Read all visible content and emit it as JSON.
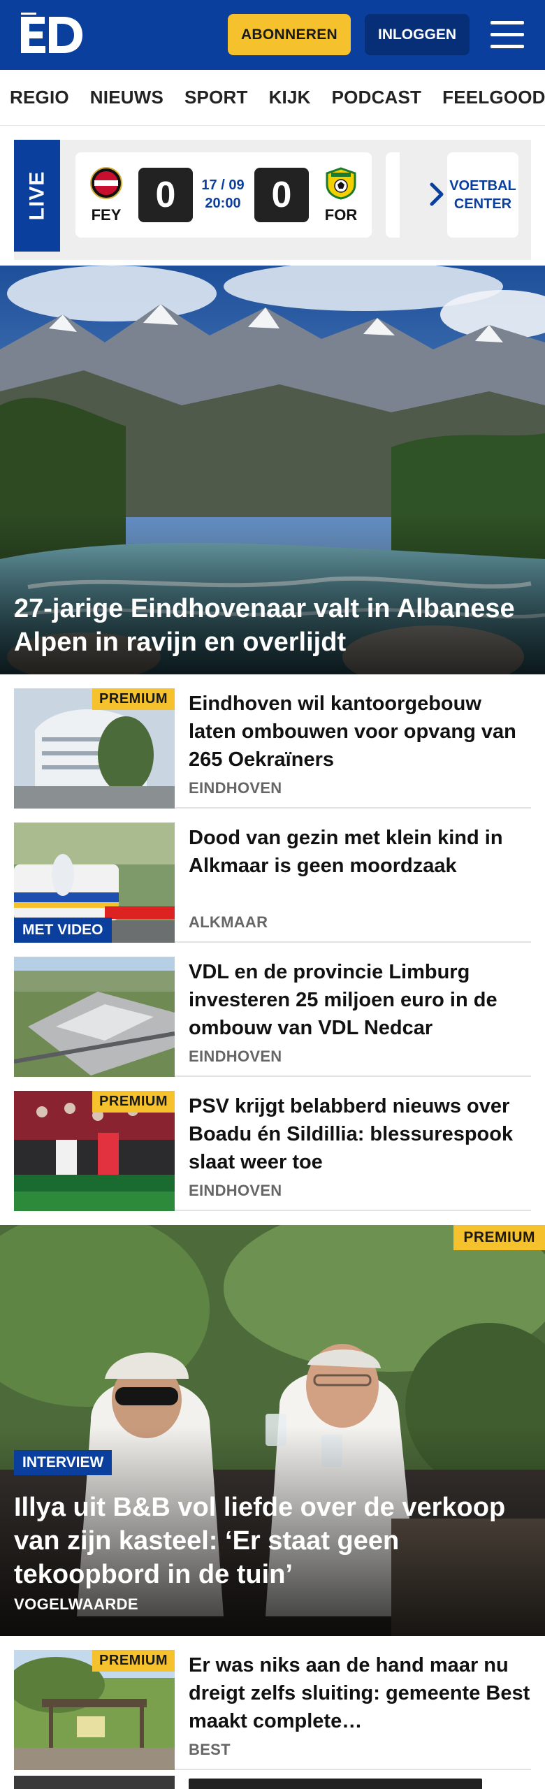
{
  "header": {
    "logo": "ED",
    "subscribe_label": "ABONNEREN",
    "login_label": "INLOGGEN"
  },
  "nav": {
    "items": [
      "REGIO",
      "NIEUWS",
      "SPORT",
      "KIJK",
      "PODCAST",
      "FEELGOOD"
    ]
  },
  "live": {
    "label": "LIVE",
    "home": {
      "abbr": "FEY",
      "score": "0"
    },
    "away": {
      "abbr": "FOR",
      "score": "0"
    },
    "date": "17 / 09",
    "time": "20:00",
    "voetbal_center": "VOETBAL CENTER"
  },
  "hero": {
    "title": "27-jarige Eindhovenaar valt in Albanese Alpen in ravijn en overlijdt"
  },
  "articles": [
    {
      "title": "Eindhoven wil kantoorgebouw laten ombouwen voor opvang van 265 Oekraïners",
      "tag": "EINDHOVEN",
      "premium": "PREMIUM"
    },
    {
      "title": "Dood van gezin met klein kind in Alkmaar is geen moordzaak",
      "tag": "ALKMAAR",
      "video": "MET VIDEO"
    },
    {
      "title": "VDL en de provincie Limburg investeren 25 miljoen euro in de ombouw van VDL Nedcar",
      "tag": "EINDHOVEN"
    },
    {
      "title": "PSV krijgt belabberd nieuws over Boadu én Sildillia: blessurespook slaat weer toe",
      "tag": "EINDHOVEN",
      "premium": "PREMIUM"
    }
  ],
  "feature": {
    "premium": "PREMIUM",
    "label": "INTERVIEW",
    "title": "Illya uit B&B vol liefde over de verkoop van zijn kasteel: ‘Er staat geen tekoopbord in de tuin’",
    "location": "VOGELWAARDE"
  },
  "article5": {
    "title": "Er was niks aan de hand maar nu dreigt zelfs sluiting: gemeente Best maakt complete…",
    "tag": "BEST",
    "premium": "PREMIUM"
  },
  "colors": {
    "brand_blue": "#0b3f9e",
    "premium_yellow": "#f5c22d"
  }
}
